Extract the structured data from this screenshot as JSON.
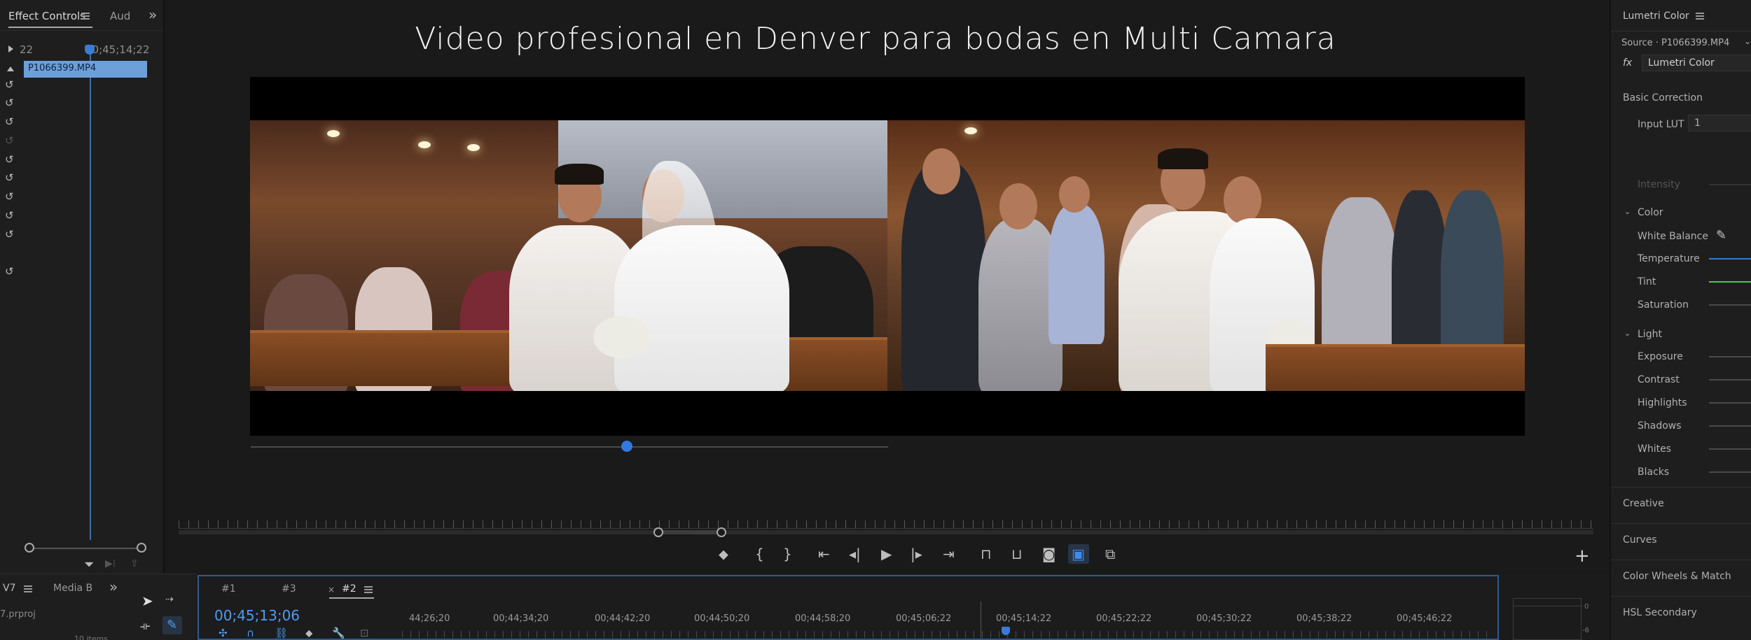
{
  "effect_controls": {
    "tab_effect_controls": "Effect Controls",
    "tab_audio": "Aud",
    "time_left": "22",
    "time_right": "00;45;14;22",
    "clip_name": "P1066399.MP4"
  },
  "program_monitor": {
    "title": "Video profesional en Denver para bodas en Multi Camara",
    "scrub_progress": 0.59
  },
  "transport": {
    "add_marker": "⬥",
    "mark_in": "{",
    "mark_out": "}",
    "go_to_in": "⇤",
    "step_back": "◂|",
    "play": "▶",
    "step_forward": "|▸",
    "go_to_out": "⇥",
    "lift": "⊓",
    "extract": "⊔",
    "export_frame": "◙",
    "compare": "▣",
    "multicam": "⧉",
    "add": "+"
  },
  "lumetri": {
    "title": "Lumetri Color",
    "source": "Source · P1066399.MP4",
    "fx_label": "fx",
    "effect_name": "Lumetri Color",
    "basic_correction": "Basic Correction",
    "input_lut": "Input LUT",
    "input_lut_value": "1",
    "intensity": "Intensity",
    "color_section": "Color",
    "white_balance": "White Balance",
    "temperature": "Temperature",
    "tint": "Tint",
    "saturation": "Saturation",
    "light_section": "Light",
    "exposure": "Exposure",
    "contrast": "Contrast",
    "highlights": "Highlights",
    "shadows": "Shadows",
    "whites": "Whites",
    "blacks": "Blacks",
    "creative": "Creative",
    "curves": "Curves",
    "color_wheels": "Color Wheels & Match",
    "hsl_secondary": "HSL Secondary",
    "colors": {
      "temperature": "#2f7be0",
      "tint": "#3bd24a"
    }
  },
  "bottom": {
    "project_tab": "V7",
    "media_tab": "Media B",
    "project_file": "7.prproj",
    "items_count": "10 items",
    "seq_tab_1": "#1",
    "seq_tab_3": "#3",
    "seq_close": "×",
    "seq_tab_2": "#2",
    "current_timecode": "00;45;13;06",
    "ruler_timecodes": [
      "44;26;20",
      "00;44;34;20",
      "00;44;42;20",
      "00;44;50;20",
      "00;44;58;20",
      "00;45;06;22",
      "00;45;14;22",
      "00;45;22;22",
      "00;45;30;22",
      "00;45;38;22",
      "00;45;46;22"
    ],
    "meter_zero": "0",
    "meter_minus": "-6"
  }
}
